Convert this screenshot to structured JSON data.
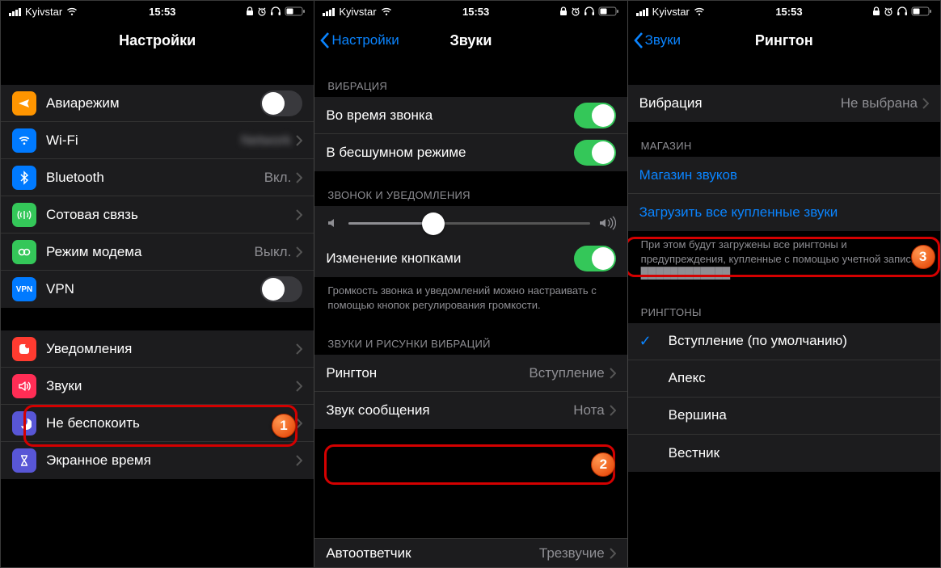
{
  "statusbar": {
    "carrier": "Kyivstar",
    "time": "15:53"
  },
  "screen1": {
    "title": "Настройки",
    "group1": [
      {
        "label": "Авиарежим",
        "icon": "airplane",
        "color": "#ff9500",
        "type": "toggle",
        "on": false
      },
      {
        "label": "Wi-Fi",
        "icon": "wifi",
        "color": "#007aff",
        "type": "link",
        "value": "████"
      },
      {
        "label": "Bluetooth",
        "icon": "bluetooth",
        "color": "#007aff",
        "type": "link",
        "value": "Вкл."
      },
      {
        "label": "Сотовая связь",
        "icon": "cellular",
        "color": "#34c759",
        "type": "link"
      },
      {
        "label": "Режим модема",
        "icon": "hotspot",
        "color": "#34c759",
        "type": "link",
        "value": "Выкл."
      },
      {
        "label": "VPN",
        "icon": "vpn",
        "color": "#007aff",
        "type": "toggle",
        "on": false
      }
    ],
    "group2": [
      {
        "label": "Уведомления",
        "icon": "notify",
        "color": "#ff3b30",
        "type": "link"
      },
      {
        "label": "Звуки",
        "icon": "sound",
        "color": "#ff2d55",
        "type": "link",
        "callout": 1
      },
      {
        "label": "Не беспокоить",
        "icon": "dnd",
        "color": "#5856d6",
        "type": "link"
      },
      {
        "label": "Экранное время",
        "icon": "screentime",
        "color": "#5856d6",
        "type": "link"
      }
    ]
  },
  "screen2": {
    "back": "Настройки",
    "title": "Звуки",
    "sec1": {
      "header": "ВИБРАЦИЯ",
      "rows": [
        {
          "label": "Во время звонка",
          "type": "toggle",
          "on": true
        },
        {
          "label": "В бесшумном режиме",
          "type": "toggle",
          "on": true
        }
      ]
    },
    "sec2": {
      "header": "ЗВОНОК И УВЕДОМЛЕНИЯ",
      "rows": [
        {
          "label": "Изменение кнопками",
          "type": "toggle",
          "on": true
        }
      ],
      "footer": "Громкость звонка и уведомлений можно настраивать с помощью кнопок регулирования громкости."
    },
    "sec3": {
      "header": "ЗВУКИ И РИСУНКИ ВИБРАЦИЙ",
      "rows": [
        {
          "label": "Рингтон",
          "value": "Вступление",
          "type": "link",
          "callout": 2
        },
        {
          "label": "Звук сообщения",
          "value": "Нота",
          "type": "link"
        }
      ]
    },
    "partial": {
      "label": "Автоответчик",
      "value": "Трезвучие"
    }
  },
  "screen3": {
    "back": "Звуки",
    "title": "Рингтон",
    "row_vib": {
      "label": "Вибрация",
      "value": "Не выбрана"
    },
    "sec_store": {
      "header": "МАГАЗИН",
      "rows": [
        {
          "label": "Магазин звуков",
          "link": true
        },
        {
          "label": "Загрузить все купленные звуки",
          "link": true,
          "callout": 3
        }
      ],
      "footer": "При этом будут загружены все рингтоны и предупреждения, купленные с помощью учетной записи ████████████."
    },
    "sec_tones": {
      "header": "РИНГТОНЫ",
      "rows": [
        {
          "label": "Вступление (по умолчанию)",
          "checked": true
        },
        {
          "label": "Апекс"
        },
        {
          "label": "Вершина"
        },
        {
          "label": "Вестник"
        }
      ]
    }
  }
}
